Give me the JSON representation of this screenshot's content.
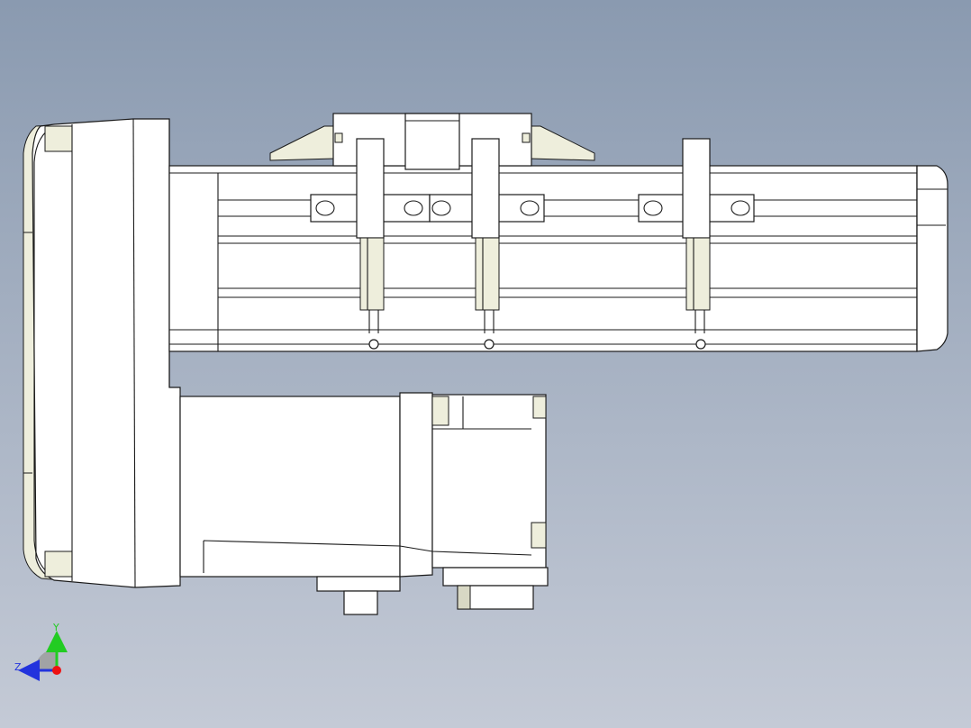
{
  "viewport": {
    "background_top": "#8a9ab0",
    "background_bottom": "#c4cad6"
  },
  "triad": {
    "y_label": "Y",
    "z_label": "Z",
    "y_color": "#22cc22",
    "z_color": "#2233dd",
    "x_color": "#ee1111"
  },
  "model": {
    "line_color": "#1a1a1a",
    "face_color": "#ffffff",
    "shade_color": "#eeeedc",
    "slider_count": 3
  }
}
